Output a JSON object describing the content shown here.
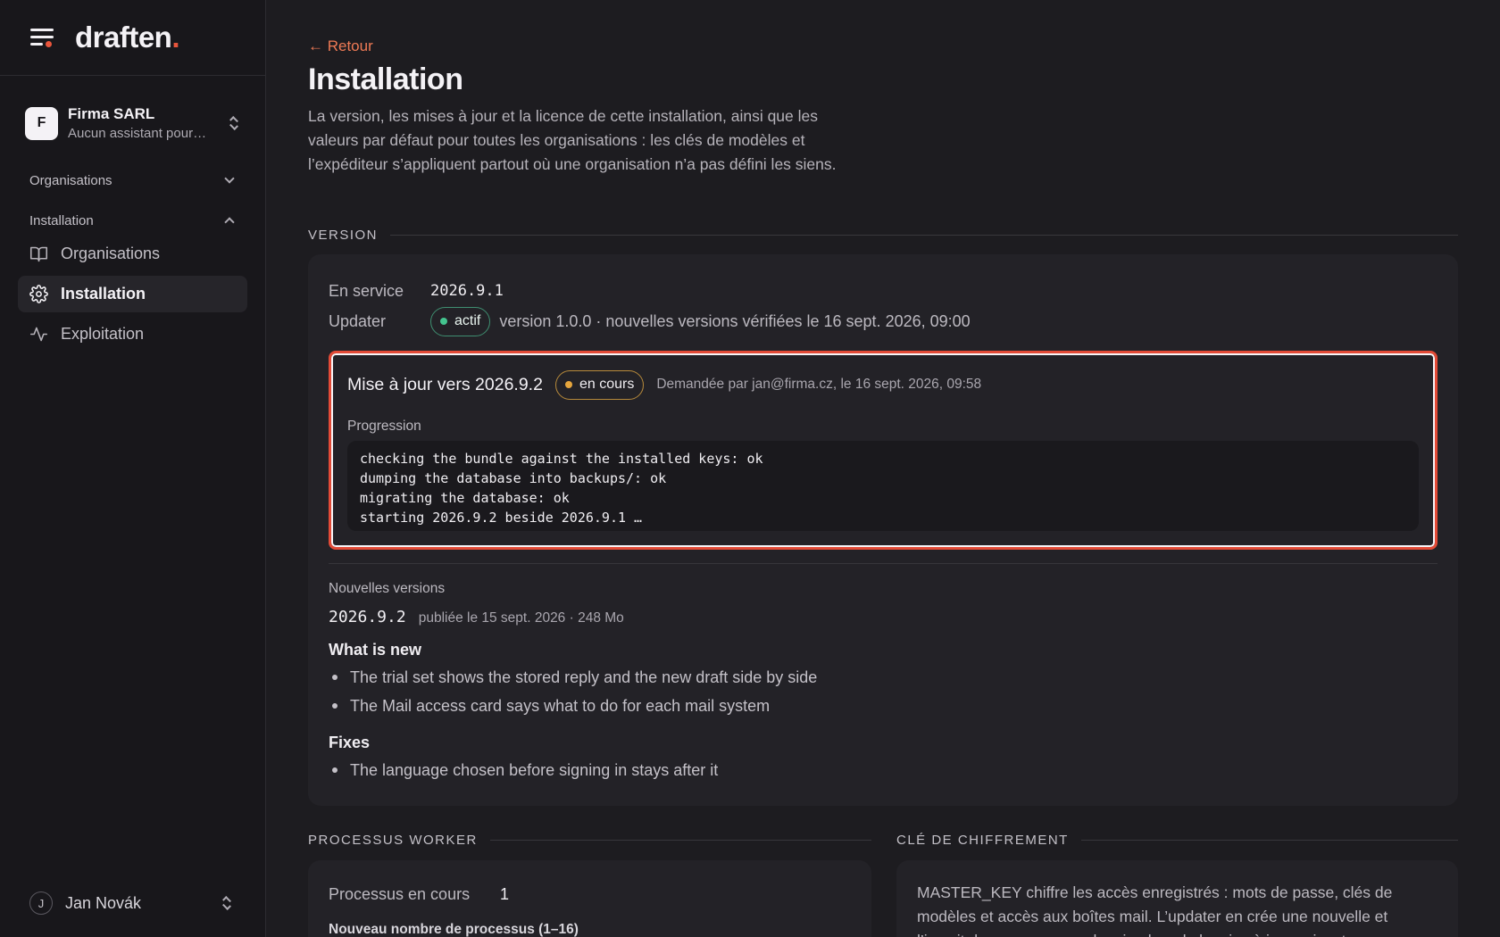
{
  "brand": {
    "name": "draften",
    "dot": "."
  },
  "org": {
    "initial": "F",
    "name": "Firma SARL",
    "subtitle": "Aucun assistant pour…"
  },
  "nav": {
    "group_organisations": "Organisations",
    "group_installation": "Installation",
    "items": [
      {
        "label": "Organisations",
        "icon": "book-icon"
      },
      {
        "label": "Installation",
        "icon": "gear-icon"
      },
      {
        "label": "Exploitation",
        "icon": "activity-icon"
      }
    ]
  },
  "user": {
    "initial": "J",
    "name": "Jan Novák"
  },
  "page": {
    "back": "← Retour",
    "title": "Installation",
    "description": "La version, les mises à jour et la licence de cette installation, ainsi que les valeurs par défaut pour toutes les organisations : les clés de modèles et l’expéditeur s’appliquent partout où une organisation n’a pas défini les siens."
  },
  "version": {
    "section_title": "VERSION",
    "in_service_label": "En service",
    "in_service_value": "2026.9.1",
    "updater_label": "Updater",
    "updater_status": "actif",
    "updater_info": "version 1.0.0 · nouvelles versions vérifiées le 16 sept. 2026, 09:00",
    "update": {
      "title": "Mise à jour vers 2026.9.2",
      "status": "en cours",
      "requested": "Demandée par jan@firma.cz, le 16 sept. 2026, 09:58",
      "progress_label": "Progression",
      "log": [
        "checking the bundle against the installed keys: ok",
        "dumping the database into backups/: ok",
        "migrating the database: ok",
        "starting 2026.9.2 beside 2026.9.1 …"
      ]
    },
    "new_versions_label": "Nouvelles versions",
    "release": {
      "version": "2026.9.2",
      "meta": "publiée le 15 sept. 2026 · 248 Mo",
      "whats_new_title": "What is new",
      "whats_new": [
        "The trial set shows the stored reply and the new draft side by side",
        "The Mail access card says what to do for each mail system"
      ],
      "fixes_title": "Fixes",
      "fixes": [
        "The language chosen before signing in stays after it"
      ]
    }
  },
  "workers": {
    "section_title": "PROCESSUS WORKER",
    "running_label": "Processus en cours",
    "running_value": "1",
    "new_count_label": "Nouveau nombre de processus (1–16)"
  },
  "encryption": {
    "section_title": "CLÉ DE CHIFFREMENT",
    "text": "MASTER_KEY chiffre les accès enregistrés : mots de passe, clés de modèles et accès aux boîtes mail. L’updater en crée une nouvelle et l’inscrit dans un nouveau keyring lors de la mise à jour suivante."
  },
  "colors": {
    "accent": "#e8553c",
    "link": "#ee7a55",
    "ok": "#44c48f",
    "warn": "#e5a53d",
    "highlight": "#e24a36"
  }
}
